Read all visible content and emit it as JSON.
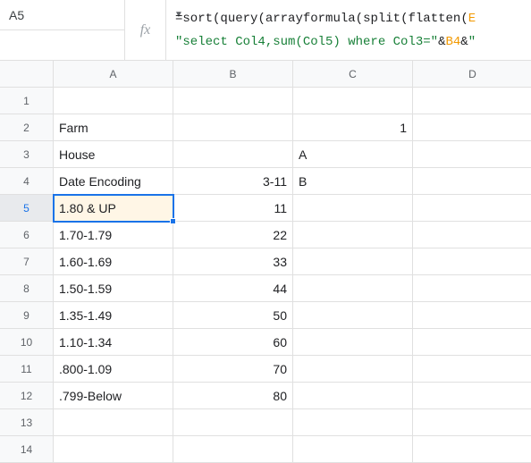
{
  "name_box": {
    "value": "A5"
  },
  "fx_label": "fx",
  "formula": {
    "prefix": "=",
    "f_sort": "sort",
    "f_query": "query",
    "f_arrayformula": "arrayformula",
    "f_split": "split",
    "f_flatten": "flatten",
    "ref1": "E",
    "str_line2_a": "\"select Col4,sum(Col5) where Col3=\"",
    "amp": "&",
    "ref2": "B4",
    "str_line2_b": "\""
  },
  "columns": [
    "A",
    "B",
    "C",
    "D"
  ],
  "row_count": 14,
  "selected_row": 5,
  "cells": {
    "A2": "Farm",
    "C2": "1",
    "A3": "House",
    "C3": "A",
    "A4": "Date Encoding",
    "B4": "3-11",
    "C4": "B",
    "A5": "1.80 & UP",
    "B5": "11",
    "A6": "1.70-1.79",
    "B6": "22",
    "A7": "1.60-1.69",
    "B7": "33",
    "A8": "1.50-1.59",
    "B8": "44",
    "A9": "1.35-1.49",
    "B9": "50",
    "A10": "1.10-1.34",
    "B10": "60",
    "A11": ".800-1.09",
    "B11": "70",
    "A12": ".799-Below",
    "B12": "80"
  },
  "chart_data": {
    "type": "table",
    "title": "",
    "columns": [
      "A",
      "B",
      "C",
      "D"
    ],
    "rows": [
      {
        "r": 2,
        "A": "Farm",
        "B": "",
        "C": 1,
        "D": ""
      },
      {
        "r": 3,
        "A": "House",
        "B": "",
        "C": "A",
        "D": ""
      },
      {
        "r": 4,
        "A": "Date Encoding",
        "B": "3-11",
        "C": "B",
        "D": ""
      },
      {
        "r": 5,
        "A": "1.80 & UP",
        "B": 11,
        "C": "",
        "D": ""
      },
      {
        "r": 6,
        "A": "1.70-1.79",
        "B": 22,
        "C": "",
        "D": ""
      },
      {
        "r": 7,
        "A": "1.60-1.69",
        "B": 33,
        "C": "",
        "D": ""
      },
      {
        "r": 8,
        "A": "1.50-1.59",
        "B": 44,
        "C": "",
        "D": ""
      },
      {
        "r": 9,
        "A": "1.35-1.49",
        "B": 50,
        "C": "",
        "D": ""
      },
      {
        "r": 10,
        "A": "1.10-1.34",
        "B": 60,
        "C": "",
        "D": ""
      },
      {
        "r": 11,
        "A": ".800-1.09",
        "B": 70,
        "C": "",
        "D": ""
      },
      {
        "r": 12,
        "A": ".799-Below",
        "B": 80,
        "C": "",
        "D": ""
      }
    ]
  }
}
